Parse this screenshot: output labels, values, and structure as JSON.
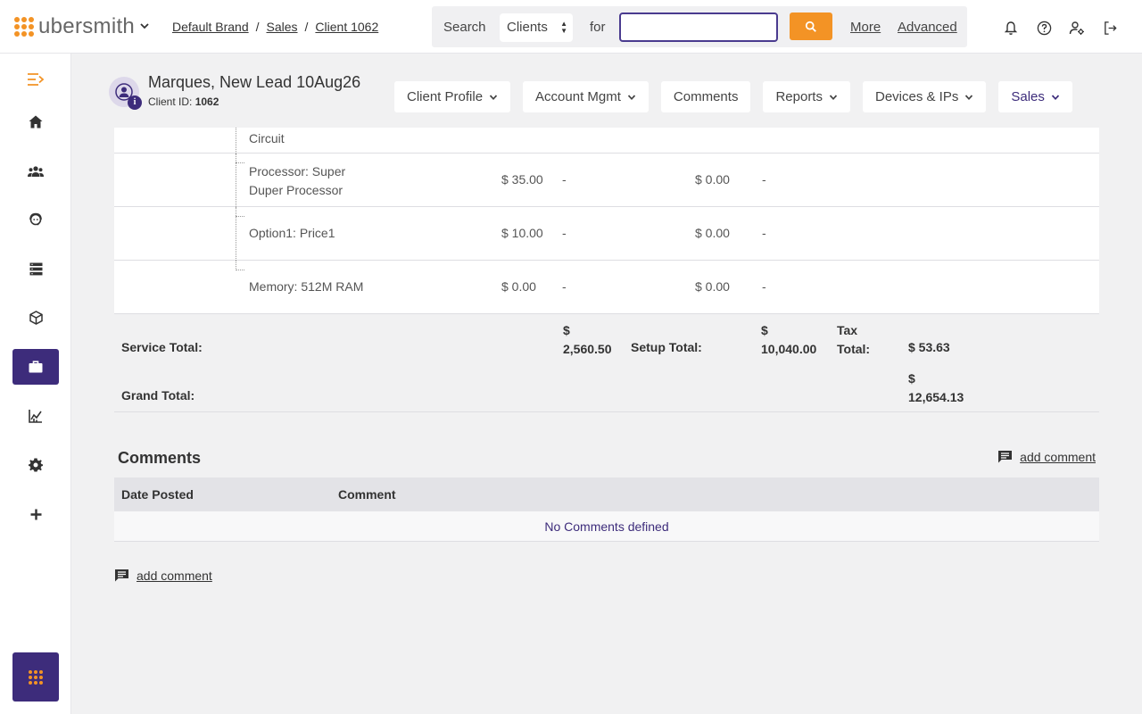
{
  "app": {
    "logo_text": "ubersmith",
    "brand_color": "#3d2c7b",
    "accent_color": "#f39325"
  },
  "breadcrumb": {
    "items": [
      "Default Brand",
      "Sales",
      "Client 1062"
    ],
    "separator": "/"
  },
  "search": {
    "label": "Search",
    "scope": "Clients",
    "for_label": "for",
    "placeholder": "",
    "value": "",
    "more_label": "More",
    "advanced_label": "Advanced"
  },
  "header_icons": [
    "bell-icon",
    "help-icon",
    "user-settings-icon",
    "logout-icon"
  ],
  "sidebar": {
    "items": [
      {
        "name": "collapse-menu",
        "icon": "menu-collapse-icon"
      },
      {
        "name": "home",
        "icon": "home-icon"
      },
      {
        "name": "clients",
        "icon": "users-icon"
      },
      {
        "name": "support",
        "icon": "support-agent-icon"
      },
      {
        "name": "devices",
        "icon": "server-icon"
      },
      {
        "name": "products",
        "icon": "box-icon"
      },
      {
        "name": "sales",
        "icon": "briefcase-icon",
        "active": true
      },
      {
        "name": "reports",
        "icon": "chart-icon"
      },
      {
        "name": "settings",
        "icon": "gear-icon"
      },
      {
        "name": "add",
        "icon": "plus-icon"
      }
    ],
    "apps_icon": "apps-grid-icon"
  },
  "client": {
    "name": "Marques, New Lead 10Aug26",
    "id_label": "Client ID:",
    "id": "1062"
  },
  "tabs": [
    {
      "label": "Client Profile",
      "dropdown": true
    },
    {
      "label": "Account Mgmt",
      "dropdown": true
    },
    {
      "label": "Comments",
      "dropdown": false
    },
    {
      "label": "Reports",
      "dropdown": true
    },
    {
      "label": "Devices & IPs",
      "dropdown": true
    },
    {
      "label": "Sales",
      "dropdown": true
    }
  ],
  "line_items": {
    "partial_row": "Circuit",
    "rows": [
      {
        "name": "Processor: Super Duper Processor",
        "name_line1": "Processor: Super",
        "name_line2": "Duper Processor",
        "price": "$ 35.00",
        "col2": "-",
        "setup": "$ 0.00",
        "col4": "-"
      },
      {
        "name": "Option1: Price1",
        "price": "$ 10.00",
        "col2": "-",
        "setup": "$ 0.00",
        "col4": "-"
      },
      {
        "name": "Memory: 512M RAM",
        "price": "$ 0.00",
        "col2": "-",
        "setup": "$ 0.00",
        "col4": "-"
      }
    ]
  },
  "totals": {
    "service_label": "Service Total:",
    "service_currency": "$",
    "service_amount": "2,560.50",
    "setup_label": "Setup Total:",
    "setup_currency": "$",
    "setup_amount": "10,040.00",
    "tax_label_line1": "Tax",
    "tax_label_line2": "Total:",
    "tax_amount": "$ 53.63",
    "grand_label": "Grand Total:",
    "grand_currency": "$",
    "grand_amount": "12,654.13"
  },
  "comments": {
    "title": "Comments",
    "add_label": "add comment",
    "columns": [
      "Date Posted",
      "Comment"
    ],
    "empty_text": "No Comments defined"
  }
}
